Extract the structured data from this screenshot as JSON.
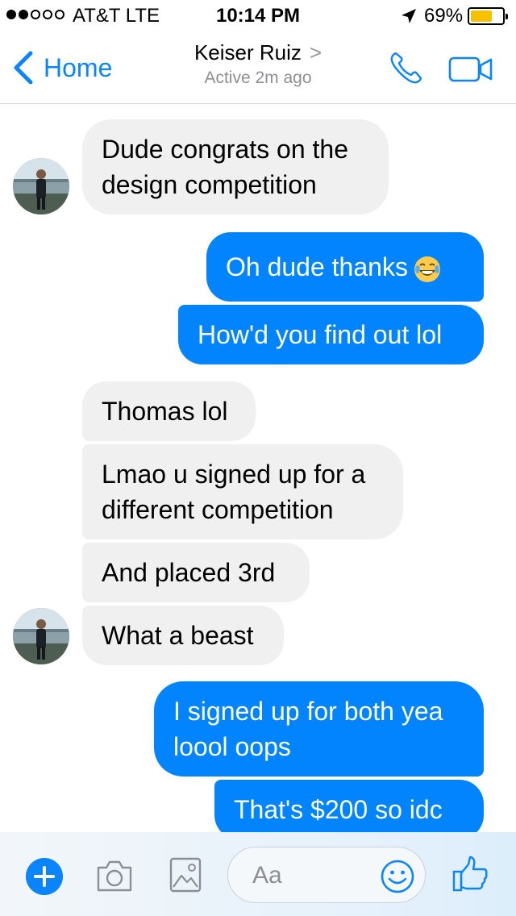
{
  "status": {
    "carrier": "AT&T   LTE",
    "time": "10:14 PM",
    "battery": "69%",
    "battery_level": 0.69,
    "signal_bars": 2,
    "signal_total": 5
  },
  "header": {
    "back_label": "Home",
    "contact_name": "Keiser Ruiz",
    "chevron": ">",
    "status": "Active 2m ago",
    "icons": [
      "chevron-left-icon",
      "phone-icon",
      "video-camera-icon"
    ],
    "accent": "#0a84ff"
  },
  "messages": [
    {
      "from": "them",
      "lines": [
        "Dude congrats on the",
        "design competition"
      ]
    },
    {
      "from": "me",
      "lines": [
        "Oh dude thanks"
      ],
      "emoji": "laughing-tears-emoji"
    },
    {
      "from": "me",
      "lines": [
        "How'd you find out lol"
      ]
    },
    {
      "from": "them",
      "lines": [
        "Thomas lol"
      ]
    },
    {
      "from": "them",
      "lines": [
        "Lmao u signed up for a",
        "different competition"
      ]
    },
    {
      "from": "them",
      "lines": [
        "And placed 3rd"
      ]
    },
    {
      "from": "them",
      "lines": [
        "What a beast"
      ]
    },
    {
      "from": "me",
      "lines": [
        "I signed up for both yea",
        "loool oops"
      ]
    },
    {
      "from": "me",
      "lines": [
        "That's $200 so idc"
      ]
    }
  ],
  "composer": {
    "placeholder": "Aa",
    "icons": [
      "plus-icon",
      "camera-icon",
      "gallery-icon",
      "emoji-icon",
      "thumbs-up-icon"
    ]
  },
  "colors": {
    "outgoing": "#0384ff",
    "incoming": "#f0f0f0",
    "battery": "#f7c000"
  }
}
